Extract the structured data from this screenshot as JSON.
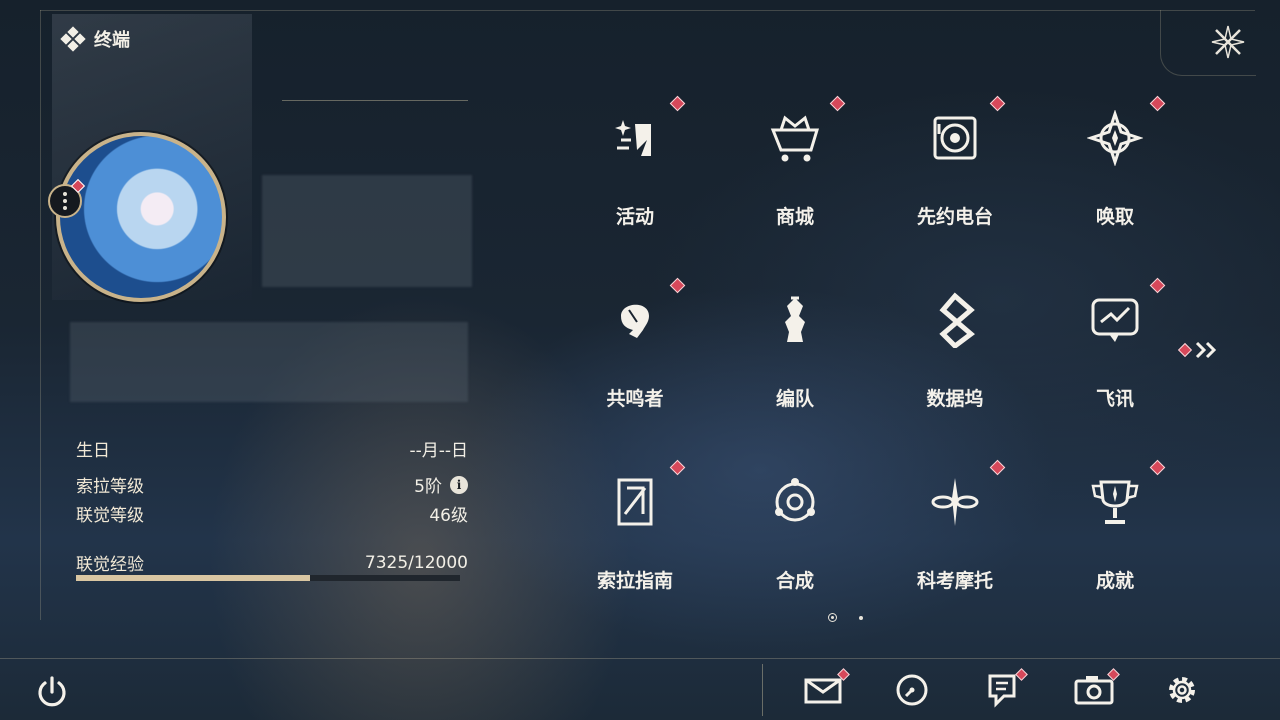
{
  "header": {
    "title": "终端",
    "title_icon": "diamond-cluster-icon",
    "close_icon": "close-star-icon"
  },
  "profile": {
    "avatar_icon": "character-avatar",
    "menu_icon": "more-vertical-icon",
    "rows": [
      {
        "key": "生日",
        "value": "--月--日"
      },
      {
        "key": "索拉等级",
        "value": "5阶"
      },
      {
        "key": "联觉等级",
        "value": "46级"
      }
    ],
    "exp": {
      "label": "联觉经验",
      "value": "7325/12000",
      "current": 7325,
      "max": 12000
    }
  },
  "menu": {
    "items": [
      {
        "label": "活动",
        "icon": "activity-icon",
        "badge": true
      },
      {
        "label": "商城",
        "icon": "shop-cart-icon",
        "badge": true
      },
      {
        "label": "先约电台",
        "icon": "radio-icon",
        "badge": true
      },
      {
        "label": "唤取",
        "icon": "convene-icon",
        "badge": true
      },
      {
        "label": "共鸣者",
        "icon": "resonator-icon",
        "badge": true
      },
      {
        "label": "编队",
        "icon": "team-icon",
        "badge": false
      },
      {
        "label": "数据坞",
        "icon": "data-bank-icon",
        "badge": false
      },
      {
        "label": "飞讯",
        "icon": "message-icon",
        "badge": true
      },
      {
        "label": "索拉指南",
        "icon": "guide-icon",
        "badge": true
      },
      {
        "label": "合成",
        "icon": "synthesis-icon",
        "badge": false
      },
      {
        "label": "科考摩托",
        "icon": "motorcycle-icon",
        "badge": true
      },
      {
        "label": "成就",
        "icon": "trophy-icon",
        "badge": true
      }
    ],
    "more_icon": "double-chevron-right-icon",
    "pages": 2,
    "current_page": 1
  },
  "toolbar": {
    "power_icon": "power-icon",
    "tools": [
      {
        "icon": "mail-icon",
        "badge": true
      },
      {
        "icon": "clock-icon",
        "badge": false
      },
      {
        "icon": "notice-icon",
        "badge": true
      },
      {
        "icon": "camera-icon",
        "badge": true
      },
      {
        "icon": "settings-gear-icon",
        "badge": false
      }
    ]
  },
  "colors": {
    "accent_gold": "#c9b38a",
    "badge_red": "#d6485a",
    "text": "#f4f1ea"
  }
}
